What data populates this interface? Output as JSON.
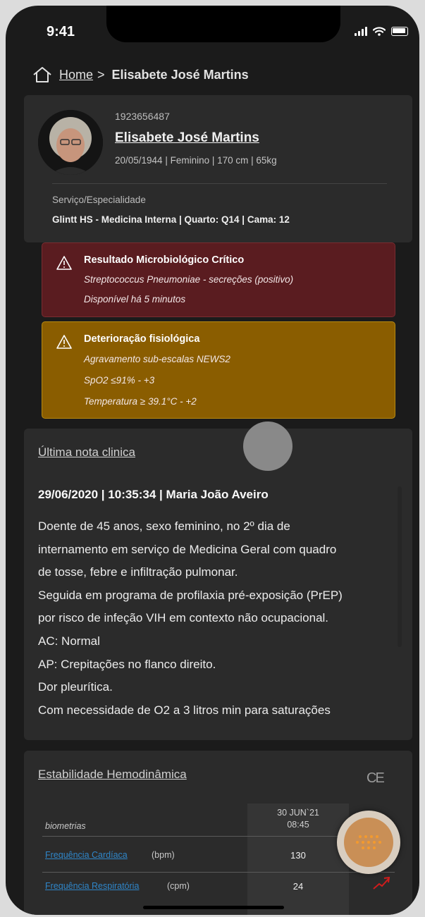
{
  "status": {
    "time": "9:41"
  },
  "breadcrumb": {
    "home": "Home",
    "separator": ">",
    "current": "Elisabete José Martins"
  },
  "patient": {
    "id": "1923656487",
    "name": "Elisabete José Martins",
    "meta": "20/05/1944 | Feminino | 170 cm | 65kg",
    "service_label": "Serviço/Especialidade",
    "service_value": "Glintt HS - Medicina Interna |  Quarto: Q14 | Cama: 12"
  },
  "alerts": [
    {
      "title": "Resultado Microbiológico Crítico",
      "lines": [
        "Streptococcus Pneumoniae - secreções (positivo)",
        "Disponível há 5 minutos"
      ],
      "color": "#5a1c20"
    },
    {
      "title": "Deterioração fisiológica",
      "lines": [
        "Agravamento sub-escalas NEWS2",
        "SpO2 ≤91% - +3",
        "Temperatura ≥ 39.1°C - +2"
      ],
      "color": "#8a5d00"
    }
  ],
  "note": {
    "title": "Última nota clinica",
    "header": "29/06/2020 | 10:35:34 | Maria João Aveiro",
    "lines": [
      "Doente de 45 anos, sexo feminino, no 2º dia de",
      "internamento em serviço de Medicina Geral com quadro",
      "de tosse, febre e infiltração pulmonar.",
      "Seguida em programa de profilaxia pré-exposição (PrEP)",
      "por risco de infeção VIH em contexto não ocupacional.",
      "AC: Normal",
      "AP: Crepitações no flanco direito.",
      "Dor pleurítica.",
      "Com necessidade de O2 a 3 litros min para saturações"
    ]
  },
  "hemo": {
    "title": "Estabilidade Hemodinâmica",
    "ce": "CE",
    "column_date": "30 JUN`21",
    "column_time": "08:45",
    "biometrics_label": "biometrias",
    "rows": [
      {
        "name": "Frequência Cardíaca",
        "unit": "(bpm)",
        "value": "130"
      },
      {
        "name": "Frequência Respiratória",
        "unit": "(cpm)",
        "value": "24"
      }
    ]
  },
  "icons": {
    "home": "home-icon",
    "warning": "warning-triangle-icon",
    "fab": "dots-grid-icon"
  },
  "colors": {
    "background": "#1b1b1b",
    "card": "#2b2b2b",
    "link": "#2f86c9",
    "fab": "#c98f56"
  }
}
